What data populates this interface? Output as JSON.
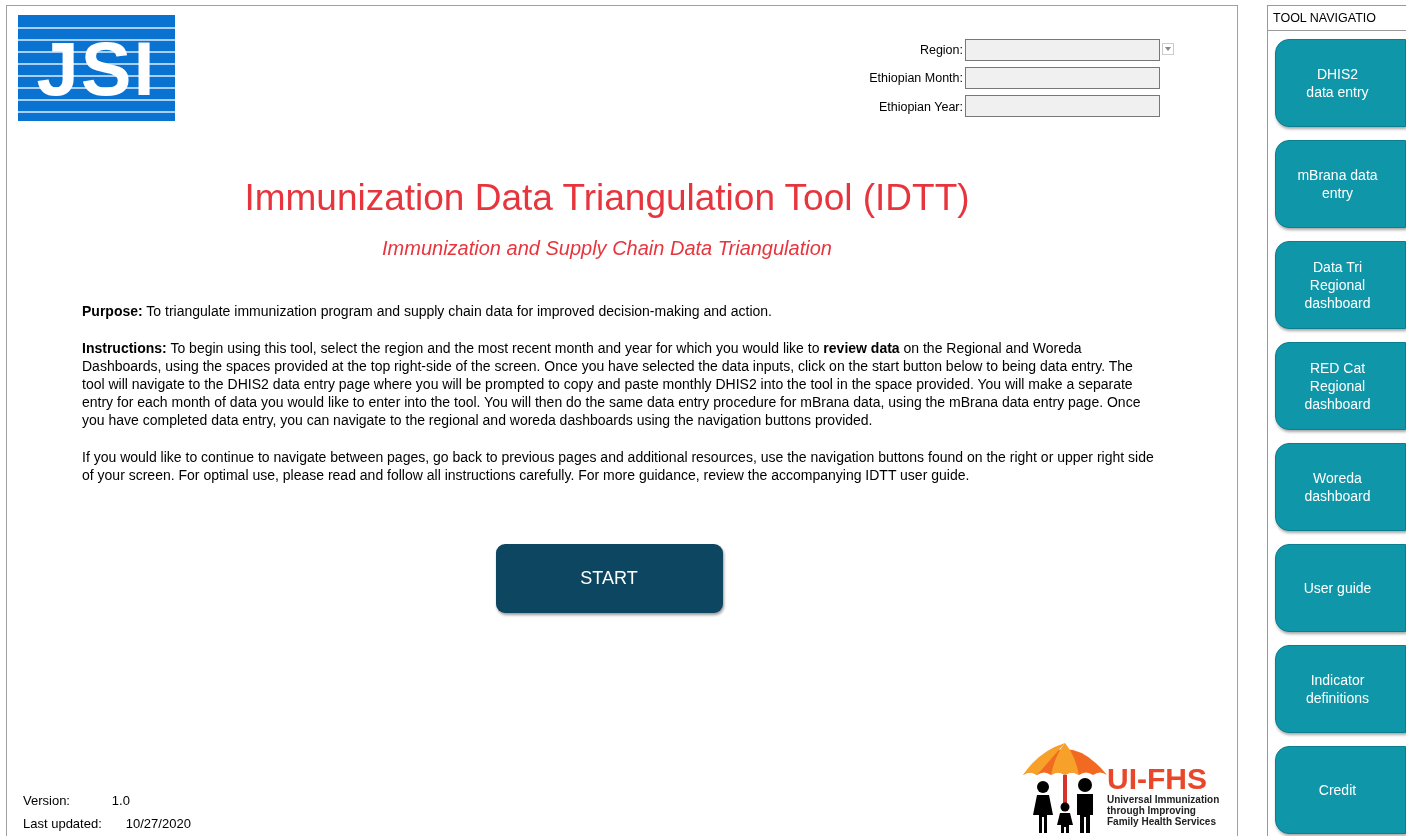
{
  "logo": {
    "text": "JSI"
  },
  "selectors": [
    {
      "label": "Region:",
      "kind": "dropdown"
    },
    {
      "label": "Ethiopian Month:",
      "kind": "text"
    },
    {
      "label": "Ethiopian Year:",
      "kind": "text"
    }
  ],
  "title": "Immunization Data Triangulation Tool (IDTT)",
  "subtitle": "Immunization and Supply Chain Data Triangulation",
  "paragraphs": [
    "**Purpose:** To triangulate immunization program and supply chain data for improved decision-making and action.",
    "**Instructions:** To begin using this tool, select the region and  the most recent month and year for which you would like to **review data** on the Regional and Woreda Dashboards, using the spaces provided at the top right-side of the screen. Once you have selected the data inputs, click on the start button below to being data entry. The tool will navigate to the DHIS2 data entry page where you will be prompted to copy and paste monthly DHIS2 into the tool in the space provided. You will make a separate entry for each month of data you would like to enter into the tool. You will then do the same data entry procedure for mBrana data, using the mBrana data entry page. Once you have completed data entry, you can navigate to the regional and woreda dashboards using the navigation buttons provided.",
    "If you would like to continue to navigate between pages, go back to previous pages and additional resources, use the navigation buttons found on the right or upper right side of your screen. For optimal use, please read and follow all instructions carefully. For more guidance, review  the accompanying IDTT user guide."
  ],
  "start_button": "START",
  "version": {
    "label": "Version:",
    "value": "1.0"
  },
  "last_updated": {
    "label": "Last updated:",
    "value": "10/27/2020"
  },
  "partner_logo": {
    "name": "UI-FHS",
    "tagline": "Universal Immunization through Improving Family Health Services"
  },
  "navigation": {
    "header": "TOOL NAVIGATIO",
    "buttons": [
      {
        "lines": [
          "DHIS2",
          "data entry"
        ]
      },
      {
        "lines": [
          "mBrana data",
          "entry"
        ]
      },
      {
        "lines": [
          "Data Tri",
          "Regional",
          "dashboard"
        ]
      },
      {
        "lines": [
          "RED Cat",
          "Regional",
          "dashboard"
        ]
      },
      {
        "lines": [
          "Woreda",
          "dashboard"
        ]
      },
      {
        "lines": [
          "User guide"
        ]
      },
      {
        "lines": [
          "Indicator",
          "definitions"
        ]
      },
      {
        "lines": [
          "Credit"
        ]
      }
    ]
  }
}
